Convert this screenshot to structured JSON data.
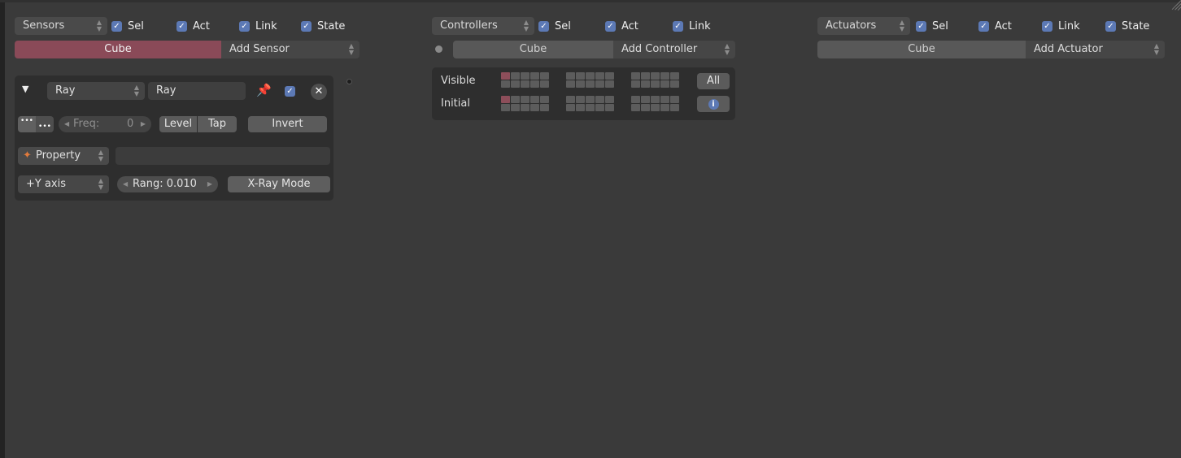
{
  "sensors": {
    "dropdown": "Sensors",
    "checks": [
      "Sel",
      "Act",
      "Link",
      "State"
    ],
    "object": "Cube",
    "add": "Add Sensor",
    "card": {
      "type": "Ray",
      "name": "Ray",
      "freq_label": "Freq:",
      "freq_value": "0",
      "level": "Level",
      "tap": "Tap",
      "invert": "Invert",
      "property": "Property",
      "property_value": "",
      "axis": "+Y axis",
      "range": "Rang: 0.010",
      "xray": "X-Ray Mode"
    }
  },
  "controllers": {
    "dropdown": "Controllers",
    "checks": [
      "Sel",
      "Act",
      "Link"
    ],
    "object": "Cube",
    "add": "Add Controller",
    "state": {
      "visible": "Visible",
      "initial": "Initial",
      "all": "All",
      "info_icon": "info-icon"
    }
  },
  "actuators": {
    "dropdown": "Actuators",
    "checks": [
      "Sel",
      "Act",
      "Link",
      "State"
    ],
    "object": "Cube",
    "add": "Add Actuator"
  },
  "colors": {
    "background": "#3a3a3a",
    "checkbox": "#5c79b5",
    "selected_object": "#8a4a58",
    "active_layer": "#8d4e5a"
  }
}
